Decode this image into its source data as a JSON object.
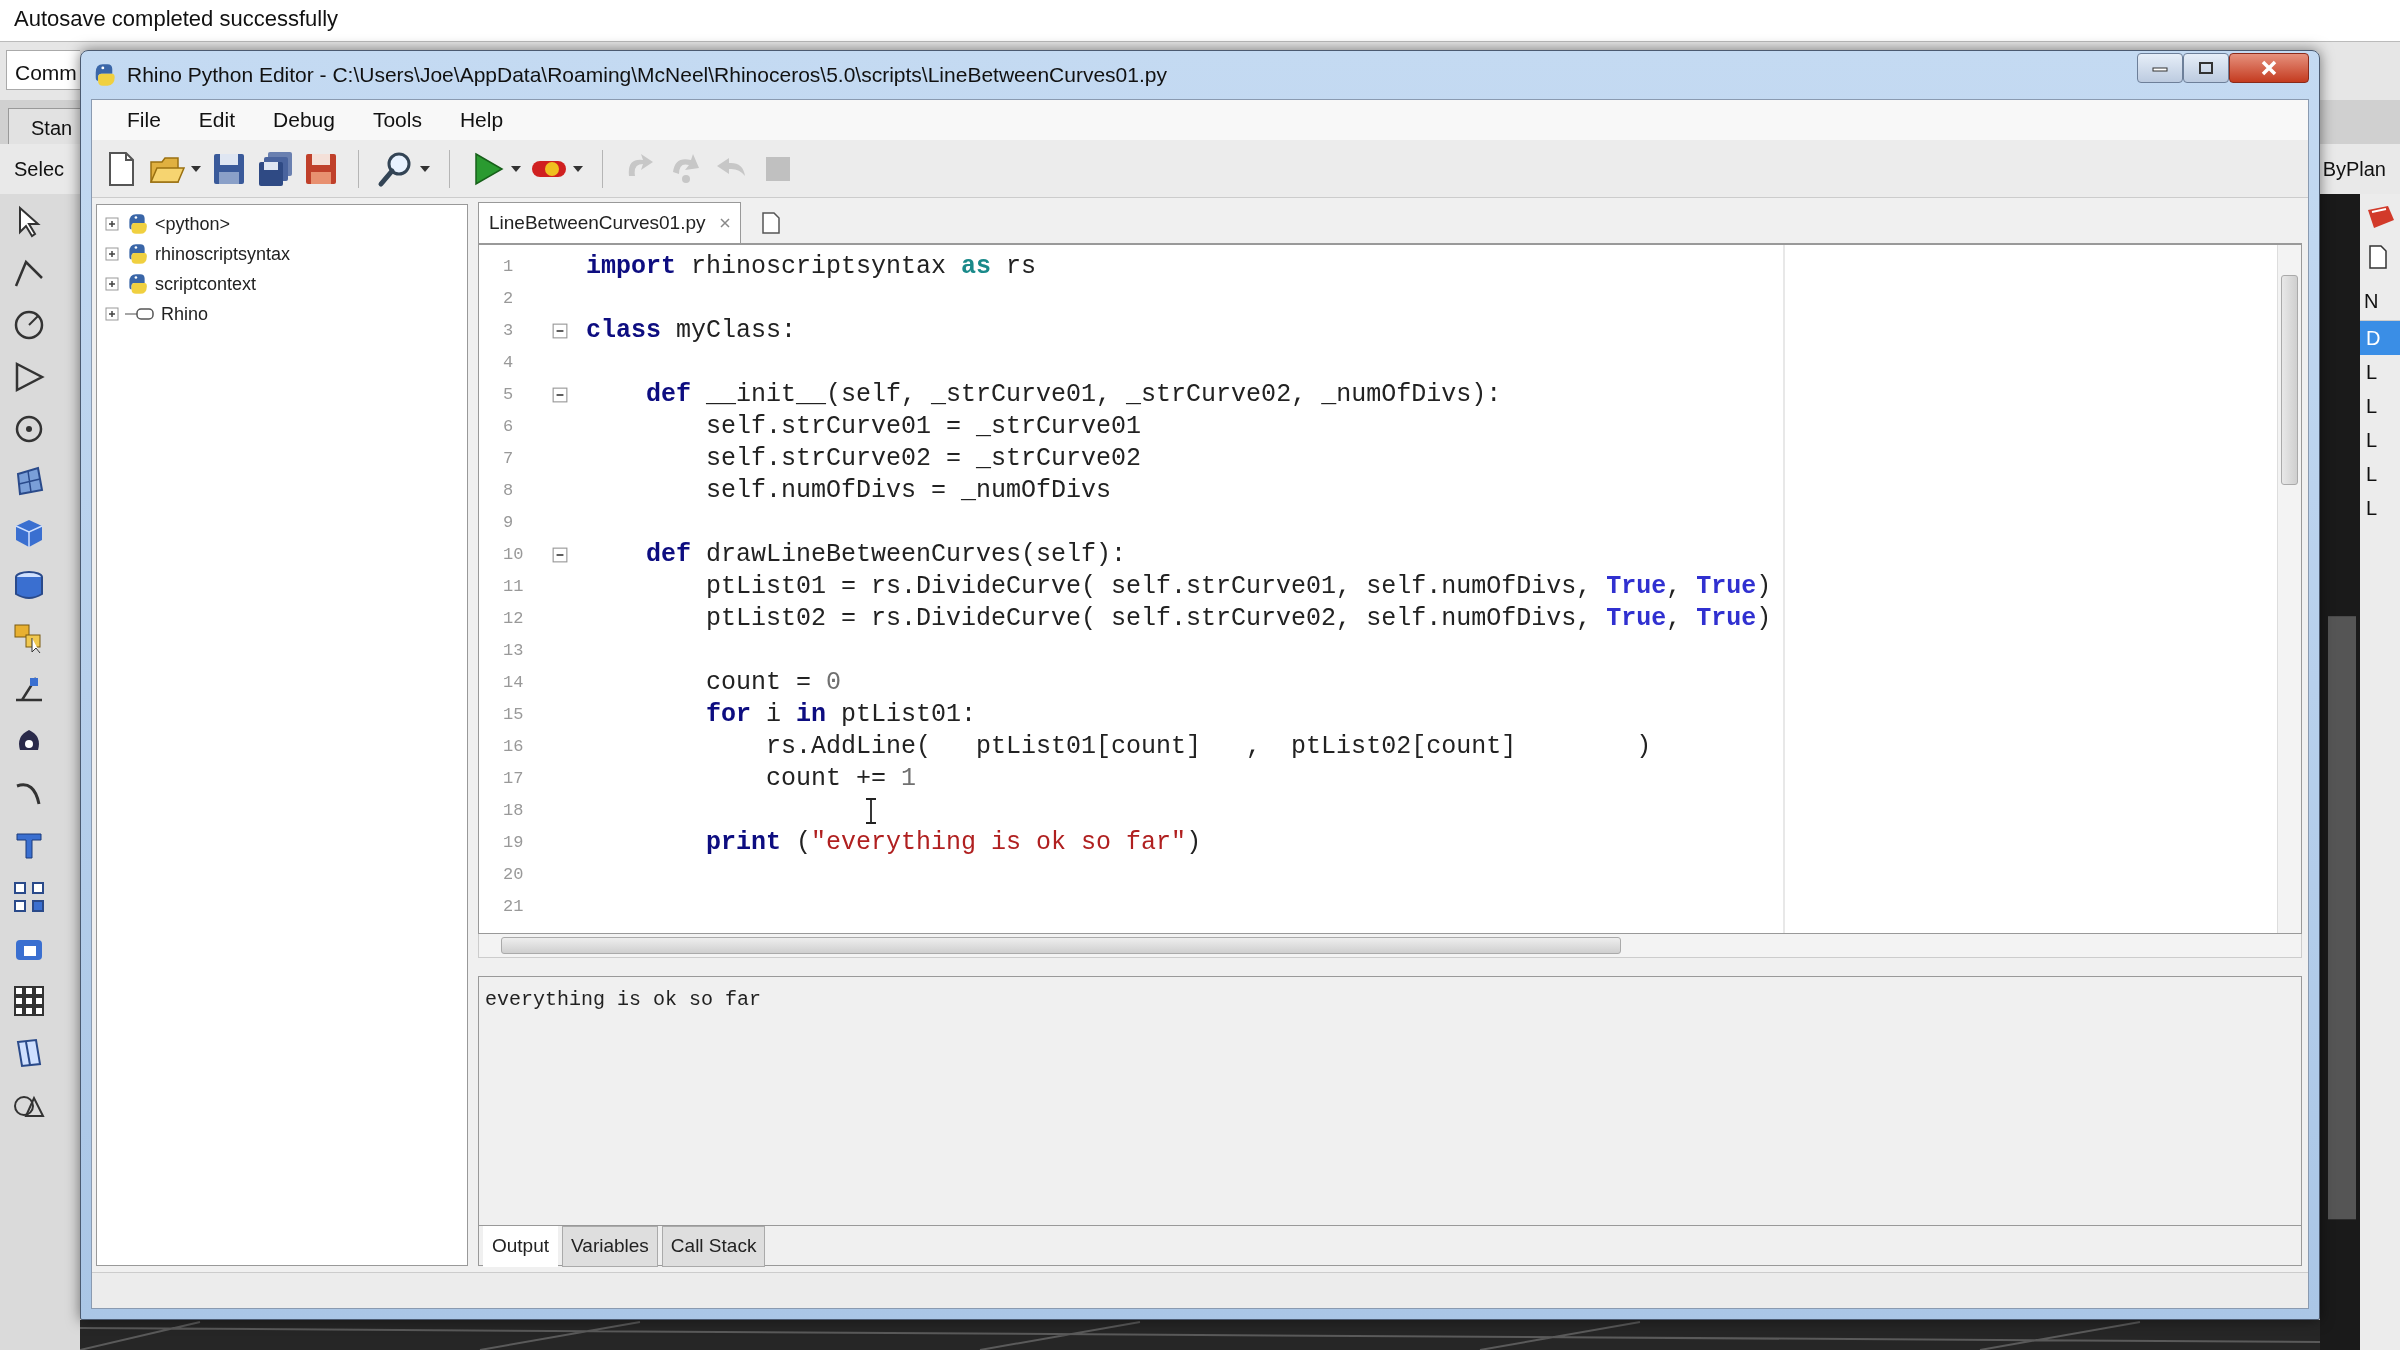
{
  "background_app": {
    "status_message": "Autosave completed successfully",
    "command_label": "Comm",
    "tab_label": "Stan",
    "select_label": "Selec",
    "layer_label": "ByPlan",
    "panel_header": "N",
    "panel_items": [
      {
        "label": "D",
        "selected": true
      },
      {
        "label": "L",
        "selected": false
      },
      {
        "label": "L",
        "selected": false
      },
      {
        "label": "L",
        "selected": false
      },
      {
        "label": "L",
        "selected": false
      },
      {
        "label": "L",
        "selected": false
      }
    ]
  },
  "window": {
    "title": "Rhino Python Editor - C:\\Users\\Joe\\AppData\\Roaming\\McNeel\\Rhinoceros\\5.0\\scripts\\LineBetweenCurves01.py"
  },
  "menu": [
    "File",
    "Edit",
    "Debug",
    "Tools",
    "Help"
  ],
  "toolbar": [
    {
      "kind": "new",
      "dropdown": false,
      "disabled": false
    },
    {
      "kind": "open",
      "dropdown": true,
      "disabled": false
    },
    {
      "kind": "save",
      "dropdown": false,
      "disabled": false
    },
    {
      "kind": "save_all",
      "dropdown": false,
      "disabled": false
    },
    {
      "kind": "save_as",
      "dropdown": false,
      "disabled": false
    },
    {
      "kind": "separator"
    },
    {
      "kind": "find",
      "dropdown": true,
      "disabled": false
    },
    {
      "kind": "separator"
    },
    {
      "kind": "run",
      "dropdown": true,
      "disabled": false
    },
    {
      "kind": "debug",
      "dropdown": true,
      "disabled": false
    },
    {
      "kind": "separator"
    },
    {
      "kind": "step_into",
      "dropdown": false,
      "disabled": true
    },
    {
      "kind": "step_over",
      "dropdown": false,
      "disabled": true
    },
    {
      "kind": "step_out",
      "dropdown": false,
      "disabled": true
    },
    {
      "kind": "stop",
      "dropdown": false,
      "disabled": true
    }
  ],
  "tree": [
    {
      "label": "<python>",
      "kind": "module",
      "expanded": false
    },
    {
      "label": "rhinoscriptsyntax",
      "kind": "module",
      "expanded": false
    },
    {
      "label": "scriptcontext",
      "kind": "module",
      "expanded": false
    },
    {
      "label": "Rhino",
      "kind": "namespace",
      "expanded": false
    }
  ],
  "editor_tabs": [
    {
      "label": "LineBetweenCurves01.py",
      "selected": true
    }
  ],
  "code_lines": [
    {
      "number": "1",
      "fold": false,
      "tokens": [
        {
          "kind": "keyword",
          "text": "import"
        },
        {
          "kind": "plain",
          "text": " rhinoscriptsyntax "
        },
        {
          "kind": "keyword2",
          "text": "as"
        },
        {
          "kind": "plain",
          "text": " rs"
        }
      ]
    },
    {
      "number": "2",
      "fold": false
    },
    {
      "number": "3",
      "fold": true,
      "tokens": [
        {
          "kind": "keyword",
          "text": "class"
        },
        {
          "kind": "plain",
          "text": " myClass:"
        }
      ]
    },
    {
      "number": "4",
      "fold": false
    },
    {
      "number": "5",
      "fold": true,
      "tokens": [
        {
          "kind": "keyword",
          "text": "    def"
        },
        {
          "kind": "plain",
          "text": " __init__(self, _strCurve01, _strCurve02, _numOfDivs):"
        }
      ]
    },
    {
      "number": "6",
      "fold": false,
      "tokens": [
        {
          "kind": "plain",
          "text": "        self.strCurve01 = _strCurve01"
        }
      ]
    },
    {
      "number": "7",
      "fold": false,
      "tokens": [
        {
          "kind": "plain",
          "text": "        self.strCurve02 = _strCurve02"
        }
      ]
    },
    {
      "number": "8",
      "fold": false,
      "tokens": [
        {
          "kind": "plain",
          "text": "        self.numOfDivs = _numOfDivs"
        }
      ]
    },
    {
      "number": "9",
      "fold": false
    },
    {
      "number": "10",
      "fold": true,
      "tokens": [
        {
          "kind": "keyword",
          "text": "    def"
        },
        {
          "kind": "plain",
          "text": " drawLineBetweenCurves(self):"
        }
      ]
    },
    {
      "number": "11",
      "fold": false,
      "tokens": [
        {
          "kind": "plain",
          "text": "        ptList01 = rs.DivideCurve( self.strCurve01, self.numOfDivs, "
        },
        {
          "kind": "constant",
          "text": "True"
        },
        {
          "kind": "plain",
          "text": ", "
        },
        {
          "kind": "constant",
          "text": "True"
        },
        {
          "kind": "plain",
          "text": ")"
        }
      ]
    },
    {
      "number": "12",
      "fold": false,
      "tokens": [
        {
          "kind": "plain",
          "text": "        ptList02 = rs.DivideCurve( self.strCurve02, self.numOfDivs, "
        },
        {
          "kind": "constant",
          "text": "True"
        },
        {
          "kind": "plain",
          "text": ", "
        },
        {
          "kind": "constant",
          "text": "True"
        },
        {
          "kind": "plain",
          "text": ")"
        }
      ]
    },
    {
      "number": "13",
      "fold": false
    },
    {
      "number": "14",
      "fold": false,
      "tokens": [
        {
          "kind": "plain",
          "text": "        count = "
        },
        {
          "kind": "number",
          "text": "0"
        }
      ]
    },
    {
      "number": "15",
      "fold": false,
      "tokens": [
        {
          "kind": "keyword",
          "text": "        for"
        },
        {
          "kind": "plain",
          "text": " i "
        },
        {
          "kind": "keyword",
          "text": "in"
        },
        {
          "kind": "plain",
          "text": " ptList01:"
        }
      ]
    },
    {
      "number": "16",
      "fold": false,
      "tokens": [
        {
          "kind": "plain",
          "text": "            rs.AddLine(   ptList01[count]   ,  ptList02[count]        )"
        }
      ]
    },
    {
      "number": "17",
      "fold": false,
      "tokens": [
        {
          "kind": "plain",
          "text": "            count += "
        },
        {
          "kind": "number",
          "text": "1"
        }
      ]
    },
    {
      "number": "18",
      "fold": false
    },
    {
      "number": "19",
      "fold": false,
      "tokens": [
        {
          "kind": "keyword",
          "text": "        print"
        },
        {
          "kind": "plain",
          "text": " ("
        },
        {
          "kind": "string",
          "text": "\"everything is ok so far\""
        },
        {
          "kind": "plain",
          "text": ")"
        }
      ]
    },
    {
      "number": "20",
      "fold": false
    },
    {
      "number": "21",
      "fold": false
    }
  ],
  "output": {
    "text": "everything is ok so far"
  },
  "output_tabs": [
    {
      "label": "Output",
      "selected": true
    },
    {
      "label": "Variables",
      "selected": false
    },
    {
      "label": "Call Stack",
      "selected": false
    }
  ]
}
